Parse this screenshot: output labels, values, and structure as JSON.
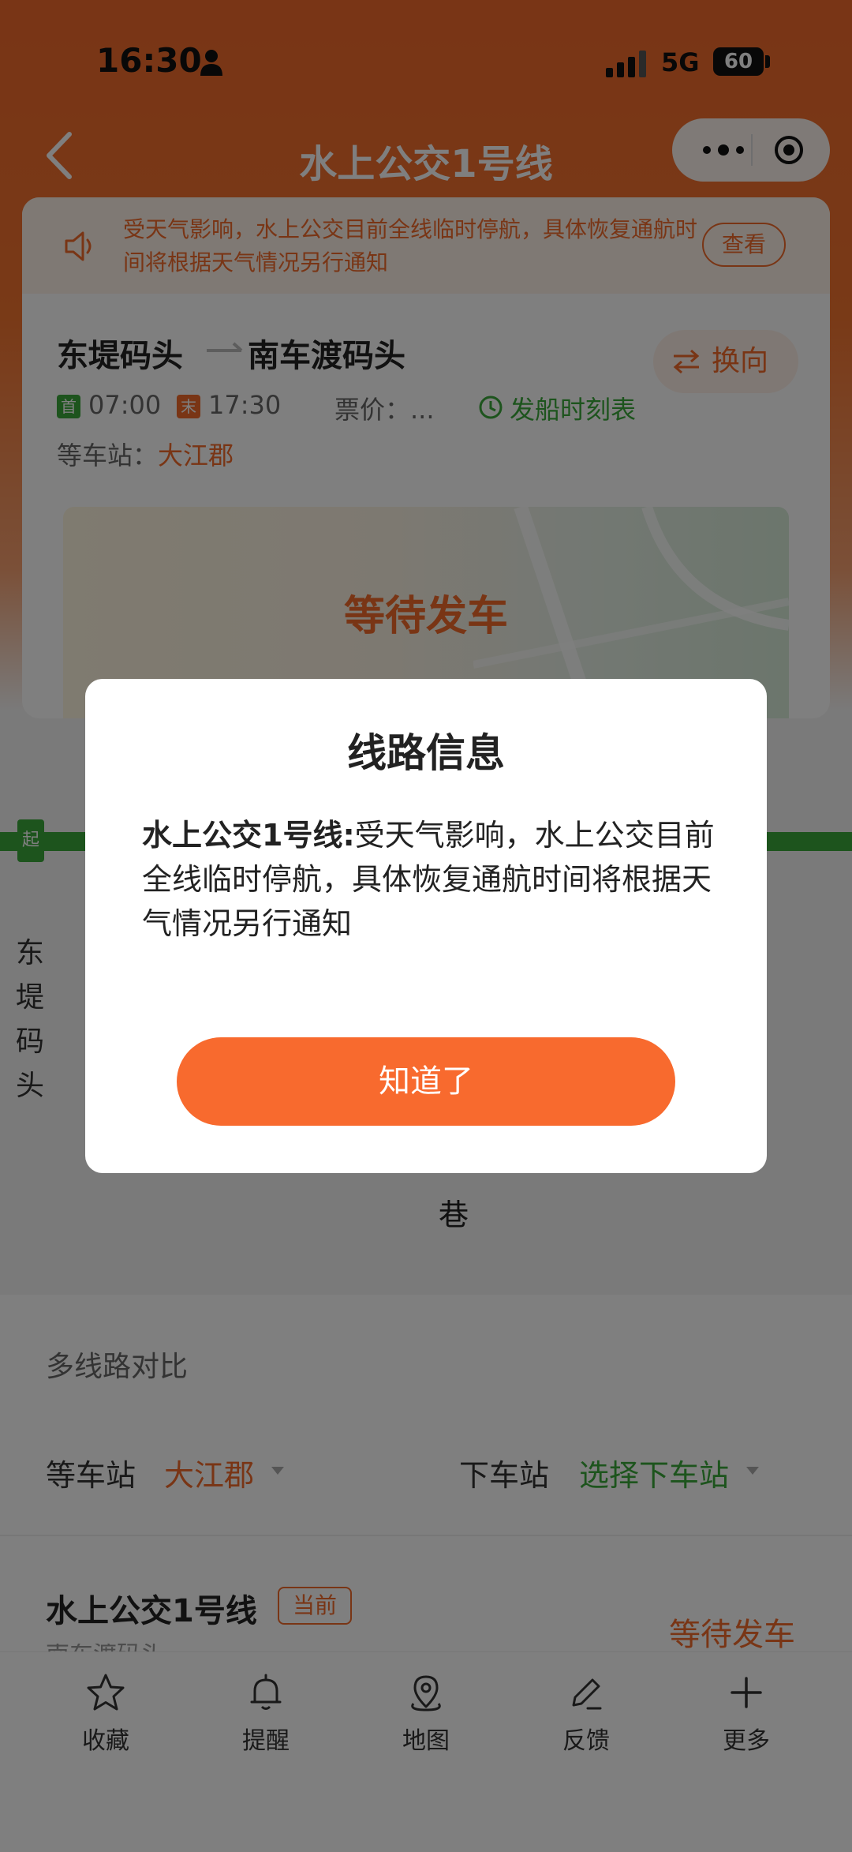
{
  "colors": {
    "brand_orange": "#f36a2a",
    "green": "#3aa83a",
    "dialog_button": "#f86a2e",
    "overlay": "rgba(0,0,0,0.5)"
  },
  "status_bar": {
    "time": "16:30",
    "network": "5G",
    "battery": "60"
  },
  "nav": {
    "title": "水上公交1号线",
    "back_icon": "chevron-left-icon",
    "capsule_icons": [
      "more-dots-icon",
      "target-icon"
    ]
  },
  "notice": {
    "text": "受天气影响，水上公交目前全线临时停航，具体恢复通航时间将根据天气情况另行通知",
    "button": "查看",
    "icon": "speaker-icon"
  },
  "route": {
    "from": "东堤码头",
    "to": "南车渡码头",
    "swap_label": "换向",
    "first_tag": "首",
    "first_time": "07:00",
    "last_tag": "末",
    "last_time": "17:30",
    "price": "票价：...",
    "schedule_link": "发船时刻表",
    "wait_station_label": "等车站：",
    "wait_station_value": "大江郡",
    "map_status": "等待发车"
  },
  "line": {
    "start_tag": "起",
    "vertical_station": "东堤码头",
    "stop_partial": "巷"
  },
  "compare": {
    "title": "多线路对比",
    "wait_label": "等车站",
    "wait_value": "大江郡",
    "down_label": "下车站",
    "down_value": "选择下车站",
    "line_name": "水上公交1号线",
    "current_badge": "当前",
    "line_status": "等待发车",
    "line_sub": "南车渡码头"
  },
  "tabs": [
    {
      "label": "收藏",
      "icon": "star-icon"
    },
    {
      "label": "提醒",
      "icon": "bell-icon"
    },
    {
      "label": "地图",
      "icon": "map-pin-icon"
    },
    {
      "label": "反馈",
      "icon": "pencil-icon"
    },
    {
      "label": "更多",
      "icon": "plus-icon"
    }
  ],
  "dialog": {
    "title": "线路信息",
    "body_bold": "水上公交1号线:",
    "body_text": "受天气影响，水上公交目前全线临时停航，具体恢复通航时间将根据天气情况另行通知",
    "button": "知道了"
  }
}
